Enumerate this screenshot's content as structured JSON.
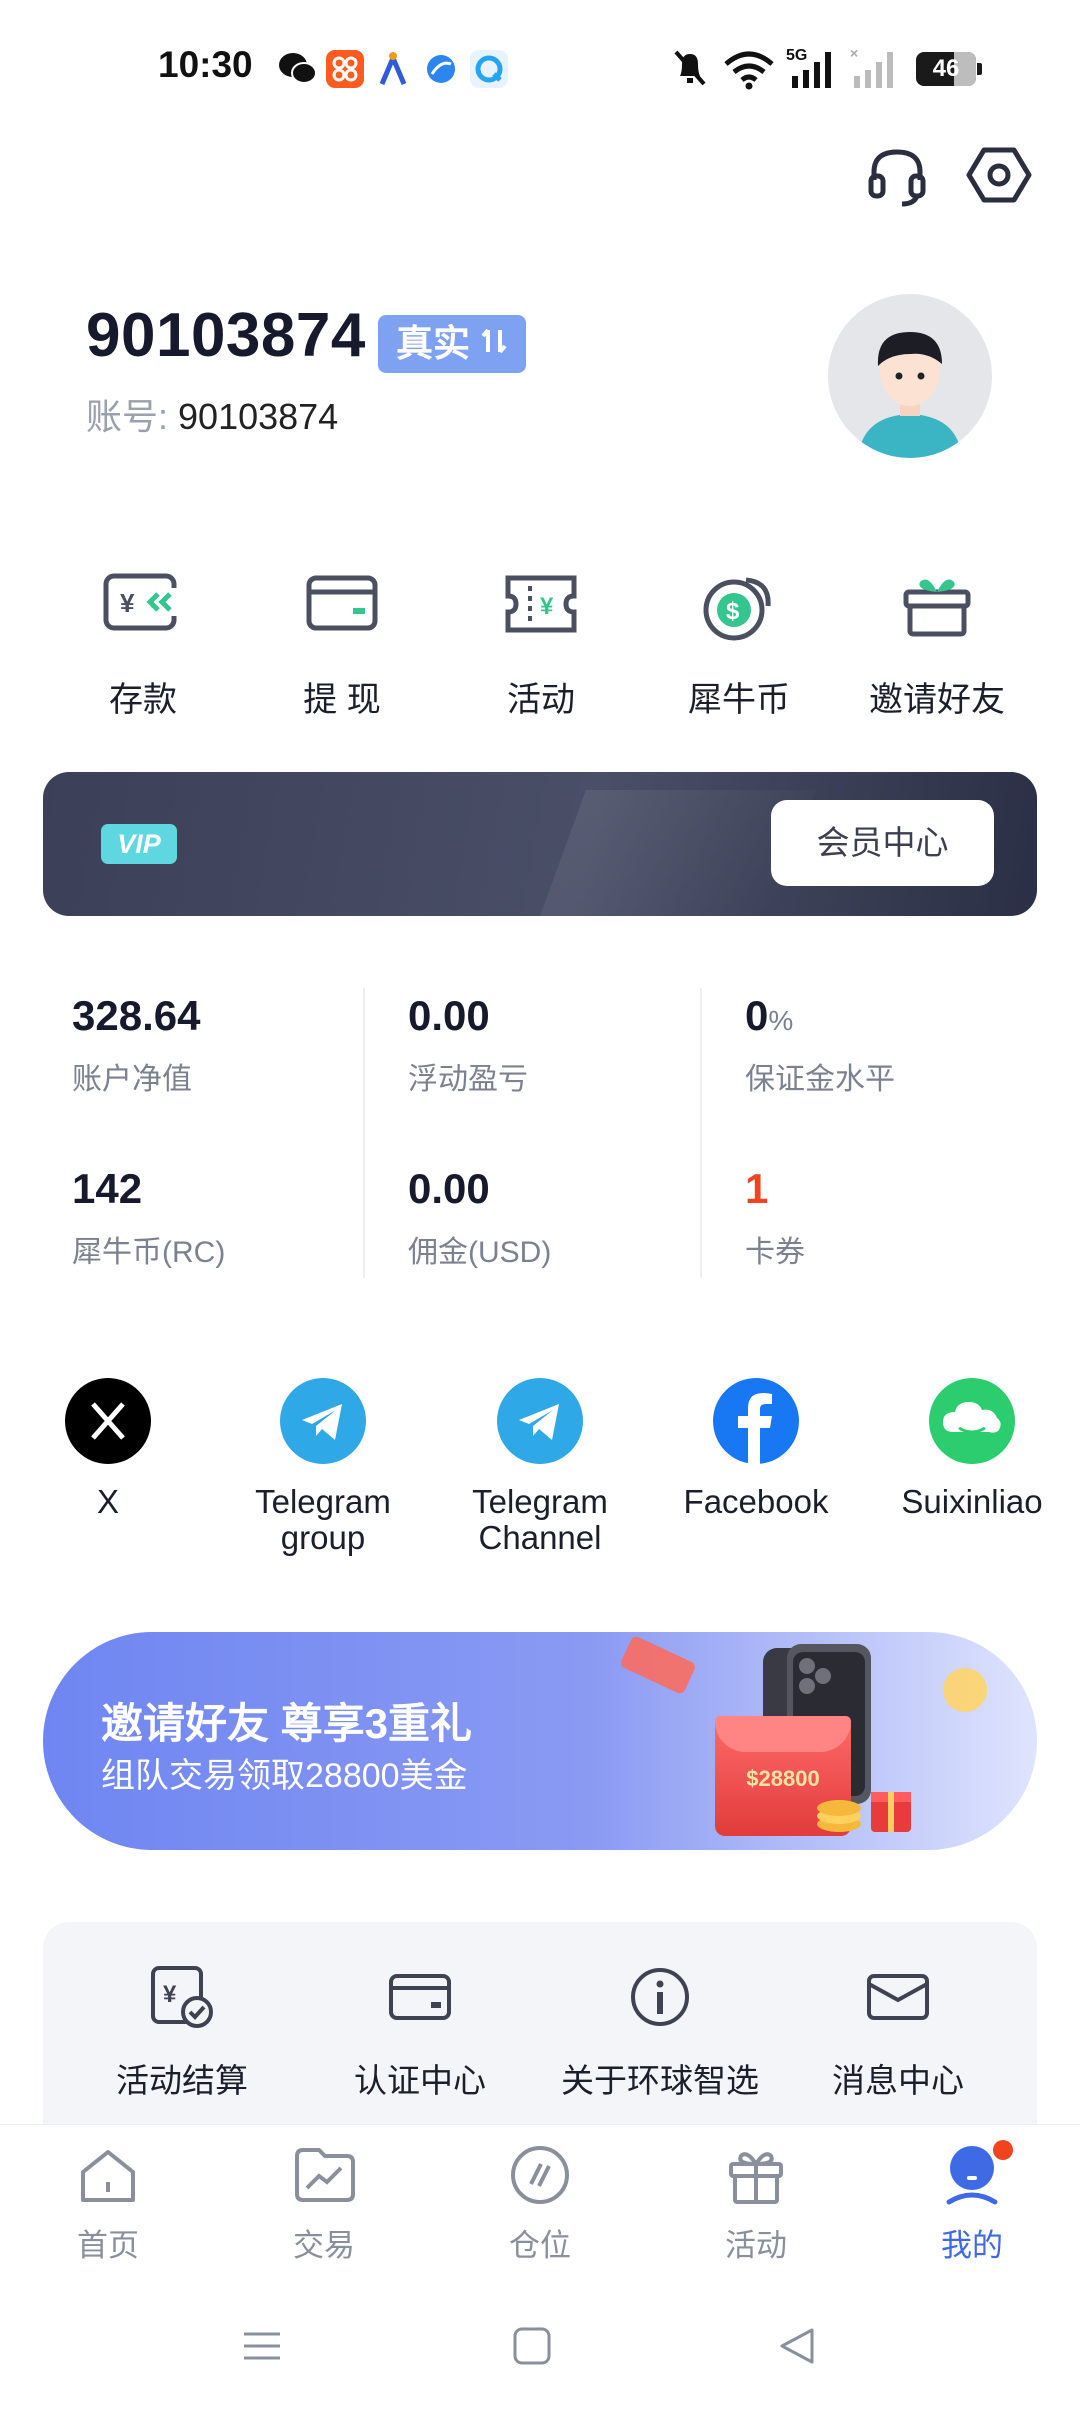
{
  "status": {
    "time": "10:30",
    "battery": "46",
    "network": "5G",
    "app_icons": [
      "wechat-icon",
      "taobao-icon",
      "app-icon",
      "browser-icon",
      "qq-browser-icon"
    ]
  },
  "header": {
    "icons": [
      "headset-icon",
      "settings-icon"
    ]
  },
  "profile": {
    "uid": "90103874",
    "badge": "真实",
    "account_label": "账号:",
    "account_value": "90103874"
  },
  "quick_actions": [
    {
      "label": "存款",
      "icon": "deposit-icon"
    },
    {
      "label": "提 现",
      "icon": "withdraw-icon"
    },
    {
      "label": "活动",
      "icon": "activity-ticket-icon"
    },
    {
      "label": "犀牛币",
      "icon": "coin-icon"
    },
    {
      "label": "邀请好友",
      "icon": "gift-icon"
    }
  ],
  "vip": {
    "badge": "VIP",
    "button": "会员中心"
  },
  "stats": [
    {
      "value": "328.64",
      "unit": "",
      "label": "账户净值"
    },
    {
      "value": "0.00",
      "unit": "",
      "label": "浮动盈亏"
    },
    {
      "value": "0",
      "unit": "%",
      "label": "保证金水平"
    },
    {
      "value": "142",
      "unit": "",
      "label": "犀牛币(RC)"
    },
    {
      "value": "0.00",
      "unit": "",
      "label": "佣金(USD)"
    },
    {
      "value": "1",
      "unit": "",
      "label": "卡券",
      "color": "#f0441f"
    }
  ],
  "social": [
    {
      "label": "X",
      "icon": "x-icon",
      "color": "#000000"
    },
    {
      "label": "Telegram group",
      "icon": "telegram-icon",
      "color": "#2ea8e6"
    },
    {
      "label": "Telegram Channel",
      "icon": "telegram-icon",
      "color": "#2ea8e6"
    },
    {
      "label": "Facebook",
      "icon": "facebook-icon",
      "color": "#1877f2"
    },
    {
      "label": "Suixinliao",
      "icon": "chat-cloud-icon",
      "color": "#2ccd6e"
    }
  ],
  "banner": {
    "title": "邀请好友 尊享3重礼",
    "subtitle": "组队交易领取28800美金",
    "envelope_text": "$28800"
  },
  "services": [
    {
      "label": "活动结算",
      "icon": "settlement-icon"
    },
    {
      "label": "认证中心",
      "icon": "card-icon"
    },
    {
      "label": "关于环球智选",
      "icon": "info-icon"
    },
    {
      "label": "消息中心",
      "icon": "mail-icon"
    }
  ],
  "tabs": [
    {
      "label": "首页",
      "icon": "home-icon",
      "active": false
    },
    {
      "label": "交易",
      "icon": "trade-chart-icon",
      "active": false
    },
    {
      "label": "仓位",
      "icon": "position-icon",
      "active": false
    },
    {
      "label": "活动",
      "icon": "gift-icon",
      "active": false
    },
    {
      "label": "我的",
      "icon": "profile-icon",
      "active": true
    }
  ],
  "colors": {
    "accent": "#3e6ae6",
    "badge": "#7ea1f1",
    "vip_badge": "#5fd7e0",
    "notification": "#f0441f"
  }
}
